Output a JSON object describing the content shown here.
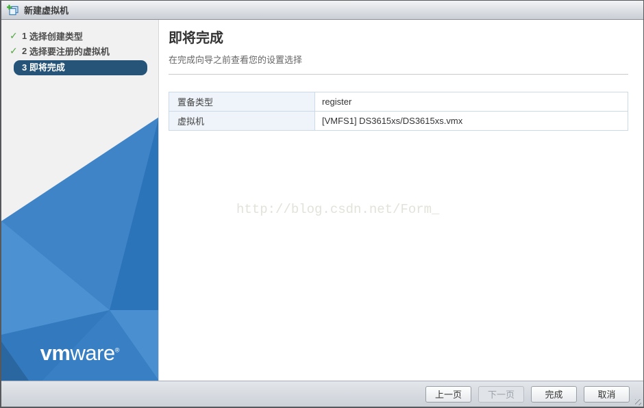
{
  "window": {
    "title": "新建虚拟机"
  },
  "icons": {
    "check": "✓"
  },
  "sidebar": {
    "steps": [
      {
        "number": "1",
        "label": "选择创建类型",
        "completed": true,
        "active": false
      },
      {
        "number": "2",
        "label": "选择要注册的虚拟机",
        "completed": true,
        "active": false
      },
      {
        "number": "3",
        "label": "即将完成",
        "completed": false,
        "active": true
      }
    ],
    "logo": {
      "bold": "vm",
      "light": "ware",
      "reg": "®"
    }
  },
  "main": {
    "heading": "即将完成",
    "subtitle": "在完成向导之前查看您的设置选择",
    "summary_table": {
      "rows": [
        {
          "label": "置备类型",
          "value": "register"
        },
        {
          "label": "虚拟机",
          "value": "[VMFS1] DS3615xs/DS3615xs.vmx"
        }
      ]
    },
    "watermark": "http://blog.csdn.net/Form_"
  },
  "footer": {
    "buttons": [
      {
        "label": "上一页",
        "disabled": false
      },
      {
        "label": "下一页",
        "disabled": true
      },
      {
        "label": "完成",
        "disabled": false
      },
      {
        "label": "取消",
        "disabled": false
      }
    ]
  },
  "colors": {
    "active_step_bg": "#255478",
    "check_green": "#55a546",
    "sidebar_blue": "#3f84c6",
    "table_label_bg": "#eef4fa",
    "table_border": "#ccd9e6"
  }
}
